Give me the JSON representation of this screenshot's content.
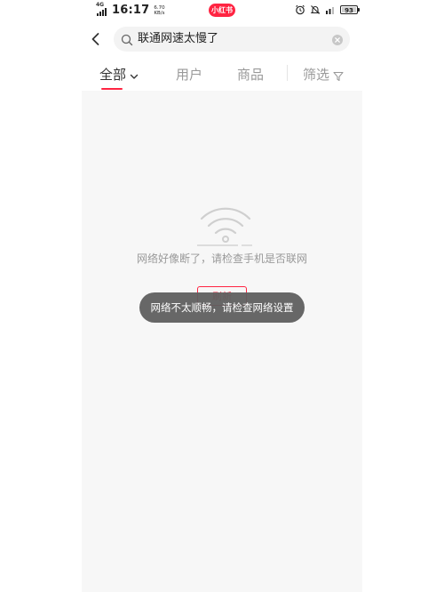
{
  "status_bar": {
    "network_type": "4G",
    "time": "16:17",
    "net_speed_value": "6.70",
    "net_speed_unit": "KB/s",
    "app_badge": "小红书",
    "battery_level": "93"
  },
  "search": {
    "query": "联通网速太慢了"
  },
  "tabs": {
    "all": "全部",
    "users": "用户",
    "goods": "商品",
    "filter": "筛选"
  },
  "empty_state": {
    "message": "网络好像断了，请检查手机是否联网",
    "refresh_label": "刷新"
  },
  "toast": {
    "message": "网络不太顺畅，请检查网络设置"
  },
  "colors": {
    "accent": "#ff2442",
    "content_background": "#f7f7f7",
    "toast_background": "#5f5f5f"
  },
  "icons": [
    "signal-icon",
    "alarm-icon",
    "mute-icon",
    "battery-icon",
    "back-icon",
    "search-icon",
    "clear-icon",
    "chevron-down-icon",
    "filter-icon",
    "wifi-off-icon"
  ]
}
